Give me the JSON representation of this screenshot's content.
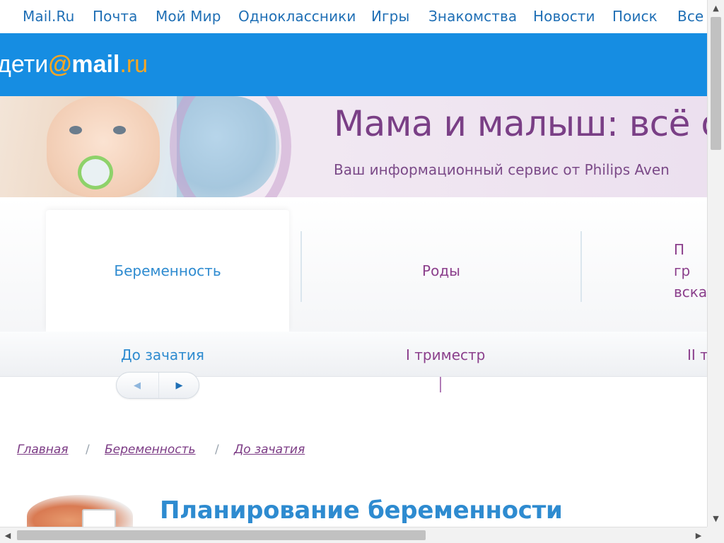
{
  "topnav": {
    "items": [
      "Mail.Ru",
      "Почта",
      "Мой Мир",
      "Одноклассники",
      "Игры",
      "Знакомства",
      "Новости",
      "Поиск",
      "Все"
    ]
  },
  "header": {
    "logo_prefix": "дети",
    "logo_at": "@",
    "logo_mail": "mail",
    "logo_dot": ".",
    "logo_ru": "ru"
  },
  "banner": {
    "title": "Мама и малыш: всё о",
    "subtitle": "Ваш информационный сервис от Philips Aven"
  },
  "categories": {
    "items": [
      {
        "label": "Беременность",
        "active": true
      },
      {
        "label": "Роды",
        "active": false
      },
      {
        "label": "П\nгр\nвскар",
        "active": false
      }
    ]
  },
  "periods": {
    "items": [
      {
        "label": "До зачатия",
        "active": true
      },
      {
        "label": "I триместр",
        "active": false
      },
      {
        "label": "II т",
        "active": false
      }
    ],
    "prev_icon": "◀",
    "next_icon": "▶"
  },
  "breadcrumbs": {
    "items": [
      "Главная",
      "Беременность",
      "До зачатия"
    ],
    "separator": "/"
  },
  "article": {
    "title": "Планирование беременности"
  },
  "scrollbars": {
    "up": "▲",
    "down": "▼",
    "left": "◀",
    "right": "▶"
  },
  "colors": {
    "header_blue": "#168de2",
    "link_blue": "#1f6fb5",
    "accent_purple": "#7a3f86",
    "logo_orange": "#f6a623"
  }
}
